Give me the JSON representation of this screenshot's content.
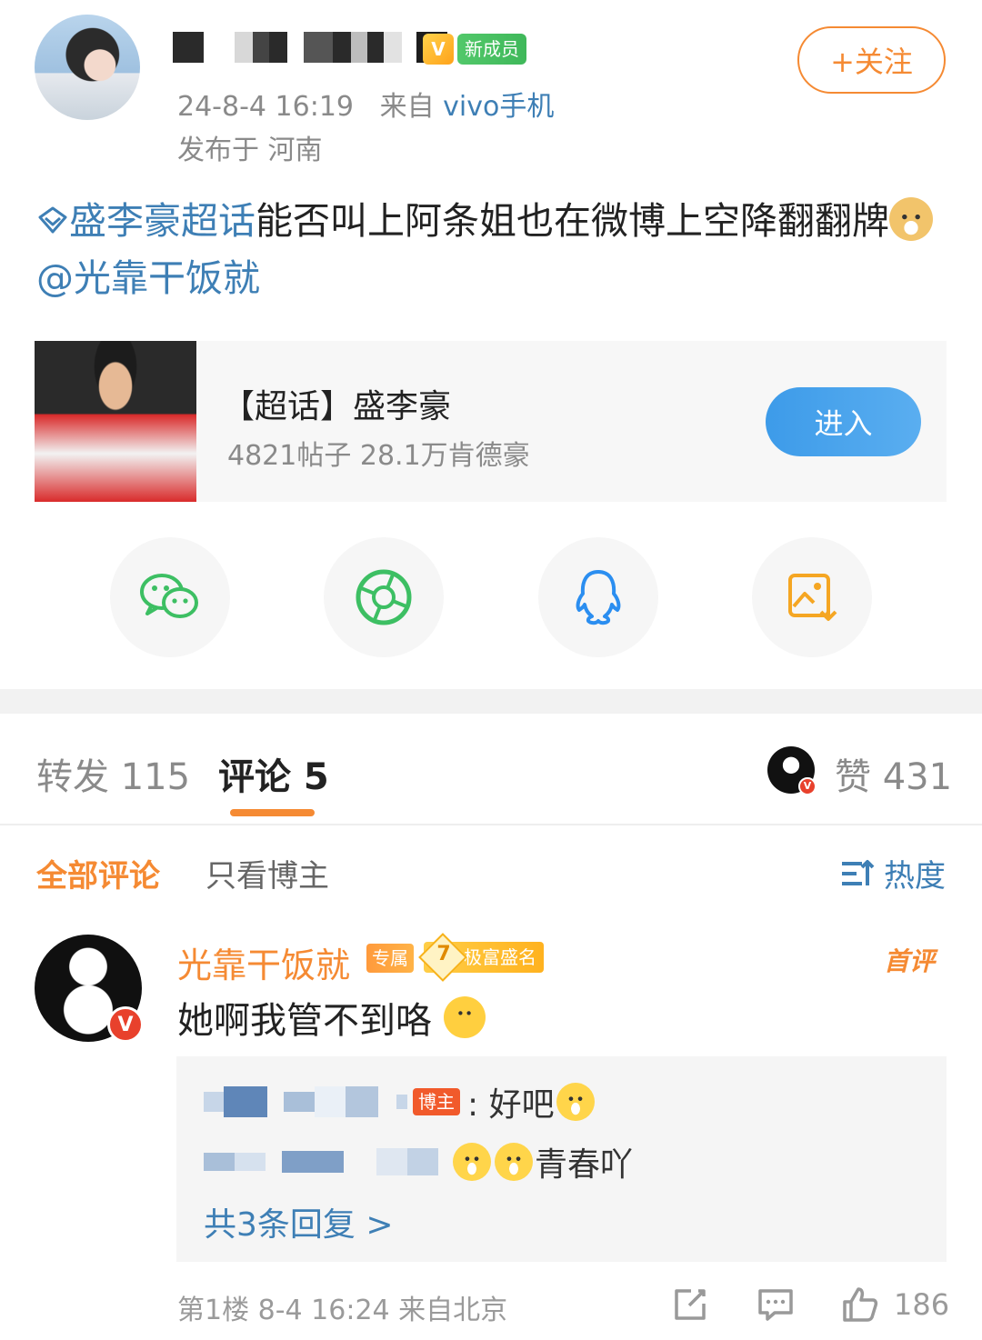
{
  "post": {
    "author_display": "",
    "badge_new_member": "新成员",
    "badge_vip_glyph": "V",
    "timestamp": "24-8-4 16:19",
    "source_prefix": "来自",
    "source": "vivo手机",
    "location": "发布于 河南",
    "follow_label": "+关注",
    "text": {
      "topic": "盛李豪超话",
      "body": "能否叫上阿条姐也在微博上空降翻翻牌",
      "mention": "@光靠干饭就"
    }
  },
  "topic_card": {
    "title": "【超话】盛李豪",
    "stats": "4821帖子 28.1万肯德豪",
    "enter_label": "进入"
  },
  "share_icons": [
    "wechat-icon",
    "moments-icon",
    "qq-icon",
    "save-image-icon"
  ],
  "tabs": {
    "repost": "转发 115",
    "comment": "评论 5",
    "like": "赞 431"
  },
  "filters": {
    "all": "全部评论",
    "owner_only": "只看博主",
    "sort": "热度"
  },
  "comment": {
    "author": "光靠干饭就",
    "badge_exclusive": "专属",
    "badge_rank_level": "7",
    "badge_rank": "极富盛名",
    "first_review": "首评",
    "text": "她啊我管不到咯",
    "verified_glyph": "V",
    "replies": [
      {
        "owner_badge": "博主",
        "text": ": 好吧"
      },
      {
        "text": "青春吖"
      }
    ],
    "more_replies": "共3条回复 >",
    "floor": "第1楼 8-4 16:24 来自北京",
    "like_count": "186"
  },
  "colors": {
    "accent": "#f58a33",
    "link": "#3e7fb5",
    "enter_button": "#4aa5ec"
  }
}
